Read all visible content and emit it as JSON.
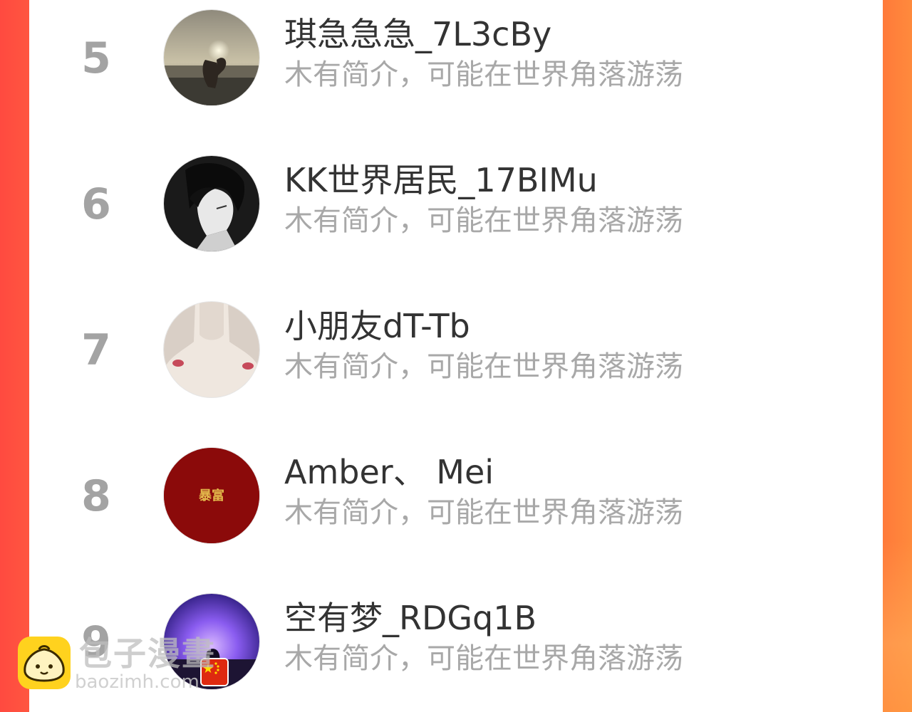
{
  "ranking": {
    "items": [
      {
        "rank": "5",
        "name": "琪急急急_7L3cBy",
        "bio": "木有简介，可能在世界角落游荡"
      },
      {
        "rank": "6",
        "name": "KK世界居民_17BIMu",
        "bio": "木有简介，可能在世界角落游荡"
      },
      {
        "rank": "7",
        "name": "小朋友dT-Tb",
        "bio": "木有简介，可能在世界角落游荡"
      },
      {
        "rank": "8",
        "name": "Amber、 Mei",
        "bio": "木有简介，可能在世界角落游荡"
      },
      {
        "rank": "9",
        "name": "空有梦_RDGq1B",
        "bio": "木有简介，可能在世界角落游荡"
      }
    ]
  },
  "avatar_8_text": "暴富",
  "watermark": {
    "title": "包子漫畫",
    "url": "baozimh.com"
  },
  "colors": {
    "side_left": "#ff4a40",
    "side_right": "#ff7a3a",
    "rank": "#a3a3a3",
    "name": "#333333",
    "bio": "#a8a8a8",
    "logo": "#ffd21e"
  }
}
